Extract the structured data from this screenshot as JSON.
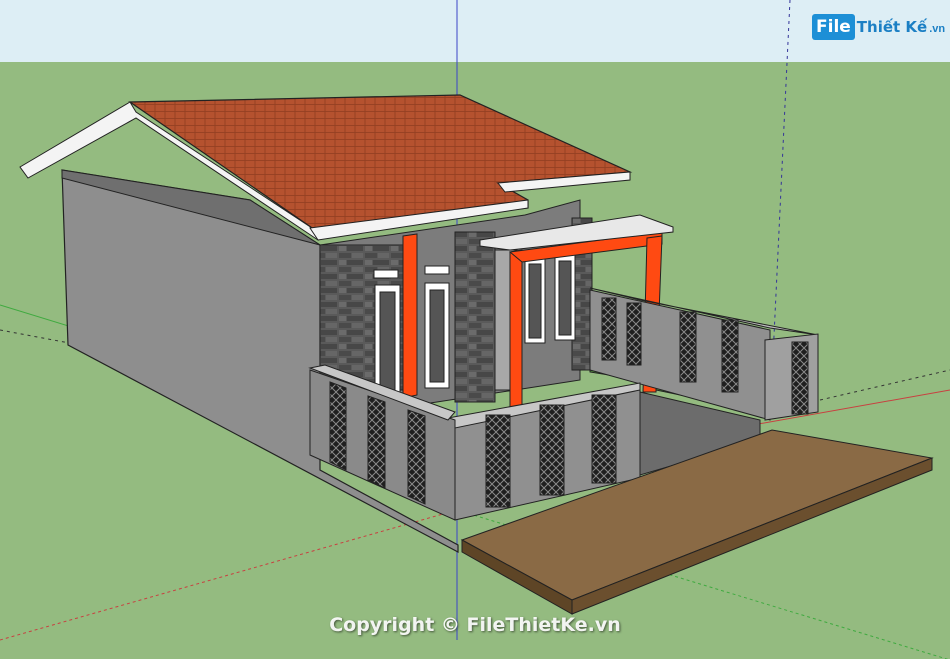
{
  "colors": {
    "sky": "#ddeef5",
    "ground": "#94bb80",
    "roof": "#b5522f",
    "wall": "#8e8e8e",
    "wall_dark": "#6f6f6f",
    "stone": "#555555",
    "accent_orange": "#ff4a12",
    "fascia": "#f4f4f4",
    "deck": "#8a6a45",
    "deck_side": "#5e4526",
    "grass_strip": "#4f8b3a",
    "patio": "#6c6c6c"
  },
  "axes": {
    "blue_axis": "#3a44c8",
    "red_axis": "#c84040",
    "green_axis": "#3faa3f"
  },
  "logo": {
    "badge": "File",
    "name": "Thiết Kế",
    "tld": ".vn"
  },
  "watermark": {
    "text": "Copyright © FileThietKe.vn"
  }
}
